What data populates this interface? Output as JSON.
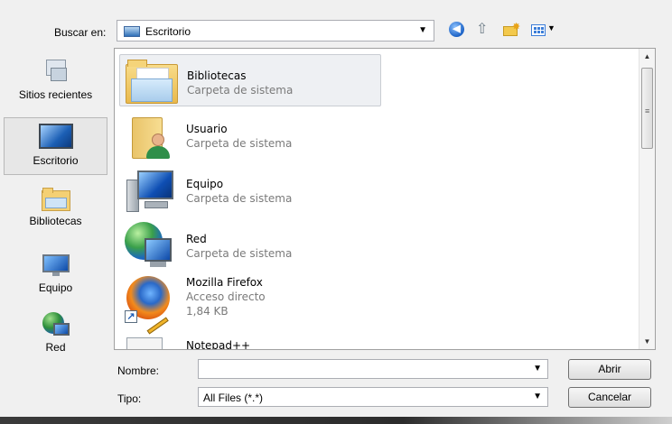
{
  "toolbar": {
    "look_in_label": "Buscar en:",
    "location": "Escritorio",
    "icons": [
      "back-icon",
      "up-folder-icon",
      "new-folder-icon",
      "view-menu-icon"
    ]
  },
  "places": [
    {
      "label": "Sitios recientes",
      "icon": "recent-places-icon"
    },
    {
      "label": "Escritorio",
      "icon": "desktop-icon",
      "selected": true
    },
    {
      "label": "Bibliotecas",
      "icon": "libraries-icon"
    },
    {
      "label": "Equipo",
      "icon": "computer-icon"
    },
    {
      "label": "Red",
      "icon": "network-icon"
    }
  ],
  "files": [
    {
      "name": "Bibliotecas",
      "type": "Carpeta de sistema",
      "icon": "libraries-folder-icon",
      "selected": true
    },
    {
      "name": "Usuario",
      "type": "Carpeta de sistema",
      "icon": "user-folder-icon"
    },
    {
      "name": "Equipo",
      "type": "Carpeta de sistema",
      "icon": "computer-icon"
    },
    {
      "name": "Red",
      "type": "Carpeta de sistema",
      "icon": "network-icon"
    },
    {
      "name": "Mozilla Firefox",
      "type": "Acceso directo",
      "size": "1,84 KB",
      "icon": "firefox-icon"
    },
    {
      "name": "Notepad++",
      "icon": "notepad-plus-icon"
    }
  ],
  "form": {
    "name_label": "Nombre:",
    "name_value": "",
    "type_label": "Tipo:",
    "type_value": "All Files (*.*)",
    "open_button": "Abrir",
    "cancel_button": "Cancelar"
  }
}
